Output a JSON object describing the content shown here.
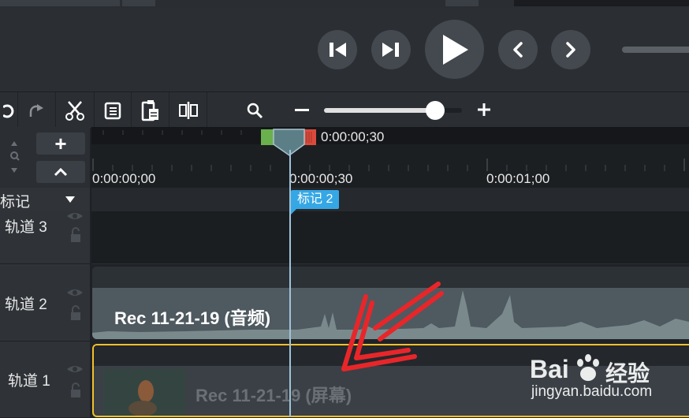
{
  "player": {
    "buttons": [
      "step-back",
      "step-forward",
      "play",
      "previous",
      "next"
    ]
  },
  "toolbar": {
    "tools": [
      "undo",
      "redo",
      "cut",
      "copy",
      "paste",
      "split",
      "zoom",
      "zoom-out",
      "zoom-slider",
      "zoom-in"
    ]
  },
  "timeline": {
    "playhead_time": "0:00:00;30",
    "ruler_labels": [
      "0:00:00;00",
      "0:00:00;30",
      "0:00:01;00"
    ],
    "markers_header": "标记",
    "marker_label": "标记 2",
    "add_track_label": "+",
    "collapse_label": "^"
  },
  "tracks": [
    {
      "name": "轨道 3"
    },
    {
      "name": "轨道 2",
      "clip": "Rec 11-21-19 (音频)"
    },
    {
      "name": "轨道 1",
      "clip": "Rec 11-21-19 (屏幕)"
    }
  ],
  "watermark": {
    "brand": "Bai",
    "brand2": "经验",
    "url": "jingyan.baidu.com"
  },
  "colors": {
    "accent": "#36a7e5",
    "selection": "#f2c02b",
    "annotation": "#e8262a"
  }
}
